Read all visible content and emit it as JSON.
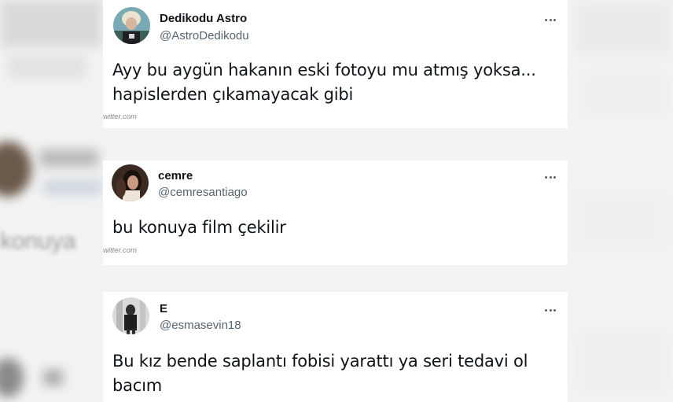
{
  "tweets": [
    {
      "name": "Dedikodu Astro",
      "handle": "@AstroDedikodu",
      "text_line1": "Ayy bu aygün hakanın eski fotoyu mu atmış yoksa...",
      "text_line2": "hapislerden çıkamayacak gibi",
      "source": "witter.com",
      "avatar_icon": "profile-photo"
    },
    {
      "name": "cemre",
      "handle": "@cemresantiago",
      "text_line1": "bu konuya film çekilir",
      "source": "witter.com",
      "avatar_icon": "profile-photo"
    },
    {
      "name": "E",
      "handle": "@esmasevin18",
      "text_line1": "Bu kız bende saplantı fobisi yarattı ya seri tedavi ol",
      "text_line2": "bacım",
      "avatar_icon": "profile-photo"
    }
  ],
  "more_icon": "more-dots-icon",
  "colors": {
    "card_background": "#ffffff",
    "name": "#0f1419",
    "handle": "#536471",
    "page_background": "#f3f3f3"
  }
}
